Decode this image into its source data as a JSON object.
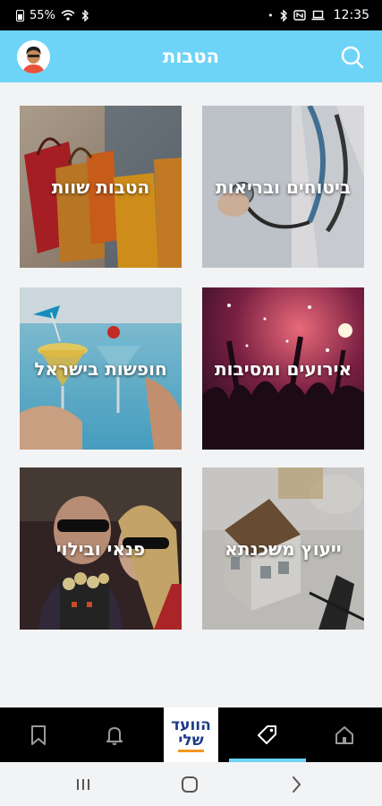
{
  "status_bar": {
    "battery": "55%",
    "time": "12:35",
    "left_icons": [
      "wifi-icon",
      "bluetooth-icon"
    ],
    "right_icons": [
      "dot-icon",
      "bluetooth-icon",
      "nfc-icon",
      "laptop-icon"
    ]
  },
  "header": {
    "title": "הטבות",
    "avatar_icon": "user-avatar-icon",
    "search_icon": "search-icon"
  },
  "tiles": [
    {
      "label": "הטבות שוות",
      "image": "shopping-bags"
    },
    {
      "label": "ביטוחים ובריאות",
      "image": "doctor-stethoscope"
    },
    {
      "label": "חופשות בישראל",
      "image": "cocktails-pool"
    },
    {
      "label": "אירועים ומסיבות",
      "image": "concert-crowd"
    },
    {
      "label": "פנאי ובילוי",
      "image": "cinema-3d"
    },
    {
      "label": "ייעוץ משכנתא",
      "image": "house-model"
    }
  ],
  "bottom_nav": {
    "items": [
      "bookmark-icon",
      "bell-icon",
      "logo",
      "tag-icon",
      "home-icon"
    ],
    "logo_line1": "הוועד",
    "logo_line2": "שלי",
    "active": "tag-icon"
  },
  "system_nav": [
    "recents-icon",
    "home-circle-icon",
    "back-chevron-icon"
  ],
  "colors": {
    "accent": "#6dd4f7",
    "logo_blue": "#1d3a8a",
    "logo_orange": "#f39a1e",
    "bar_black": "#000000"
  }
}
